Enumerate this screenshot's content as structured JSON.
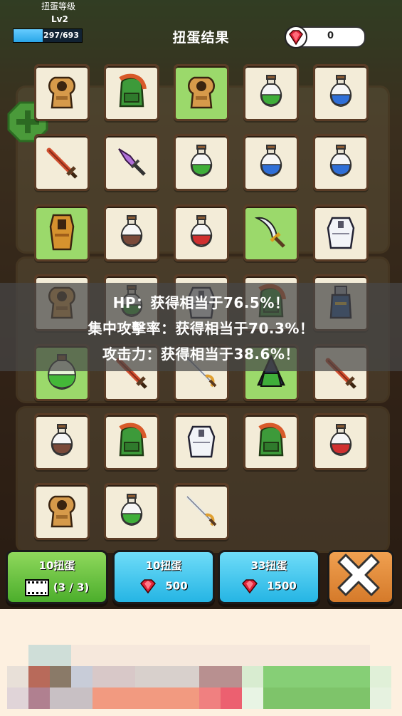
{
  "header": {
    "level_label": "扭蛋等级",
    "level_value": "Lv2",
    "xp_text": "297/693",
    "xp_fraction": 0.43,
    "title": "扭蛋结果",
    "gem_count": "0"
  },
  "results": {
    "items": [
      {
        "icon": "hooded-cloak-icon",
        "rarity": "common"
      },
      {
        "icon": "green-backpack-icon",
        "rarity": "common"
      },
      {
        "icon": "hooded-cloak-icon",
        "rarity": "rare"
      },
      {
        "icon": "green-potion-icon",
        "rarity": "common"
      },
      {
        "icon": "blue-potion-icon",
        "rarity": "common"
      },
      {
        "icon": "sword-icon",
        "rarity": "common"
      },
      {
        "icon": "purple-dagger-icon",
        "rarity": "common"
      },
      {
        "icon": "green-potion-icon",
        "rarity": "common"
      },
      {
        "icon": "blue-potion-icon",
        "rarity": "common"
      },
      {
        "icon": "blue-potion-icon",
        "rarity": "common"
      },
      {
        "icon": "tall-cloak-icon",
        "rarity": "rare"
      },
      {
        "icon": "brown-potion-icon",
        "rarity": "common"
      },
      {
        "icon": "red-potion-icon",
        "rarity": "common"
      },
      {
        "icon": "scimitar-icon",
        "rarity": "rare"
      },
      {
        "icon": "white-armor-icon",
        "rarity": "common"
      },
      {
        "icon": "hooded-cloak-icon",
        "rarity": "common"
      },
      {
        "icon": "green-potion-icon",
        "rarity": "common"
      },
      {
        "icon": "white-armor-icon",
        "rarity": "common"
      },
      {
        "icon": "green-backpack-icon",
        "rarity": "common"
      },
      {
        "icon": "blue-statue-icon",
        "rarity": "common"
      },
      {
        "icon": "large-green-potion-icon",
        "rarity": "rare"
      },
      {
        "icon": "sword-icon",
        "rarity": "common"
      },
      {
        "icon": "rapier-icon",
        "rarity": "common"
      },
      {
        "icon": "dark-cloak-icon",
        "rarity": "rare"
      },
      {
        "icon": "sword-icon",
        "rarity": "common"
      },
      {
        "icon": "brown-potion-icon",
        "rarity": "common"
      },
      {
        "icon": "green-backpack-icon",
        "rarity": "common"
      },
      {
        "icon": "white-armor-icon",
        "rarity": "common"
      },
      {
        "icon": "green-backpack-icon",
        "rarity": "common"
      },
      {
        "icon": "red-potion-icon",
        "rarity": "common"
      },
      {
        "icon": "hooded-cloak-icon",
        "rarity": "common"
      },
      {
        "icon": "green-potion-icon",
        "rarity": "common"
      },
      {
        "icon": "rapier-icon",
        "rarity": "common"
      }
    ]
  },
  "notice": {
    "line1": "HP：获得相当于76.5%！",
    "line2": "集中攻擊率：获得相当于70.3%！",
    "line3": "攻击力：获得相当于38.6%！"
  },
  "buttons": {
    "ad_label": "10扭蛋",
    "ad_count": "(3 / 3)",
    "ten_label": "10扭蛋",
    "ten_cost": "500",
    "thirtythree_label": "33扭蛋",
    "thirtythree_cost": "1500"
  },
  "colors": {
    "rare_slot": "#9bd96b",
    "common_slot": "#f3ecd8",
    "ad_button": "#4cae2c",
    "gem_button": "#25b5e4",
    "close_button": "#d57a2a"
  }
}
